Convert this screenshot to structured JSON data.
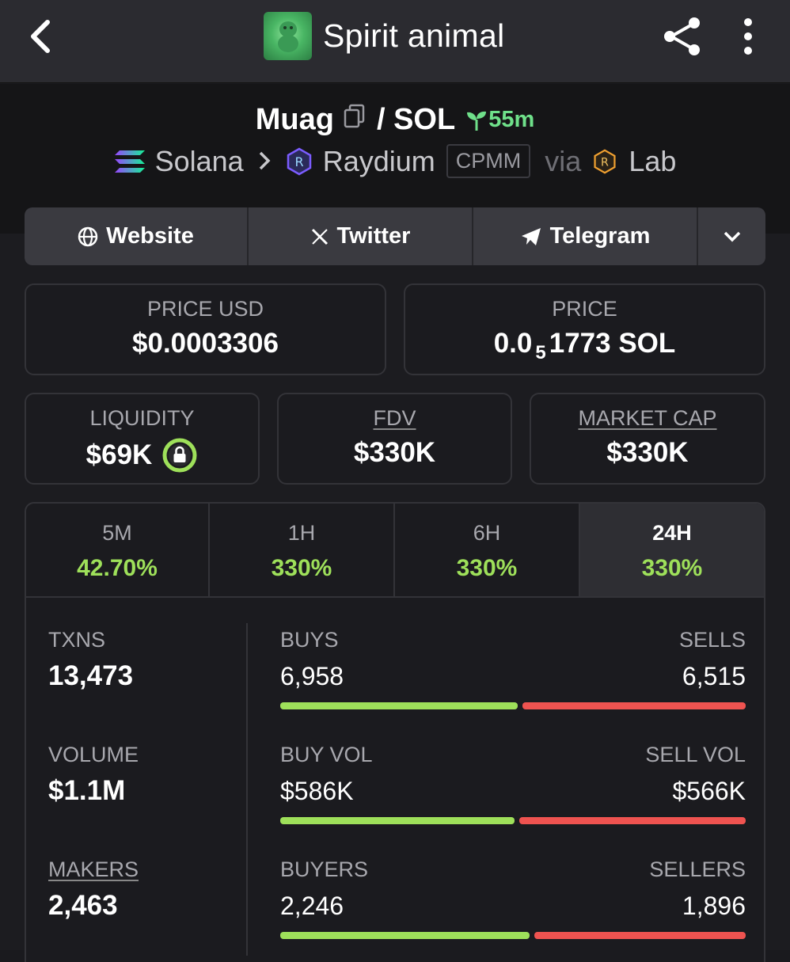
{
  "header": {
    "title": "Spirit animal"
  },
  "pair": {
    "base": "Muag",
    "quote": "/ SOL",
    "age": "55m",
    "chain": "Solana",
    "dex": "Raydium",
    "pool_type": "CPMM",
    "via": "via",
    "launchpad": "Lab"
  },
  "links": {
    "website": "Website",
    "twitter": "Twitter",
    "telegram": "Telegram"
  },
  "price_usd": {
    "label": "PRICE USD",
    "value": "$0.0003306"
  },
  "price_native": {
    "label": "PRICE",
    "prefix": "0.0",
    "zeros": "5",
    "suffix": "1773 SOL"
  },
  "liquidity": {
    "label": "LIQUIDITY",
    "value": "$69K"
  },
  "fdv": {
    "label": "FDV",
    "value": "$330K"
  },
  "market_cap": {
    "label": "MARKET CAP",
    "value": "$330K"
  },
  "timeframes": [
    {
      "label": "5M",
      "change": "42.70%"
    },
    {
      "label": "1H",
      "change": "330%"
    },
    {
      "label": "6H",
      "change": "330%"
    },
    {
      "label": "24H",
      "change": "330%",
      "active": true
    }
  ],
  "stats": {
    "txns": {
      "label": "TXNS",
      "value": "13,473"
    },
    "volume": {
      "label": "VOLUME",
      "value": "$1.1M"
    },
    "makers": {
      "label": "MAKERS",
      "value": "2,463"
    },
    "buys": {
      "label": "BUYS",
      "value": "6,958"
    },
    "sells": {
      "label": "SELLS",
      "value": "6,515"
    },
    "buy_vol": {
      "label": "BUY VOL",
      "value": "$586K"
    },
    "sell_vol": {
      "label": "SELL VOL",
      "value": "$566K"
    },
    "buyers": {
      "label": "BUYERS",
      "value": "2,246"
    },
    "sellers": {
      "label": "SELLERS",
      "value": "1,896"
    }
  },
  "ratios": {
    "buys_share": 0.516,
    "buy_vol_share": 0.509,
    "buyers_share": 0.542
  },
  "colors": {
    "positive": "#9ee05a",
    "negative": "#ef5350",
    "age": "#6fe08a",
    "background": "#1a1a1e"
  }
}
